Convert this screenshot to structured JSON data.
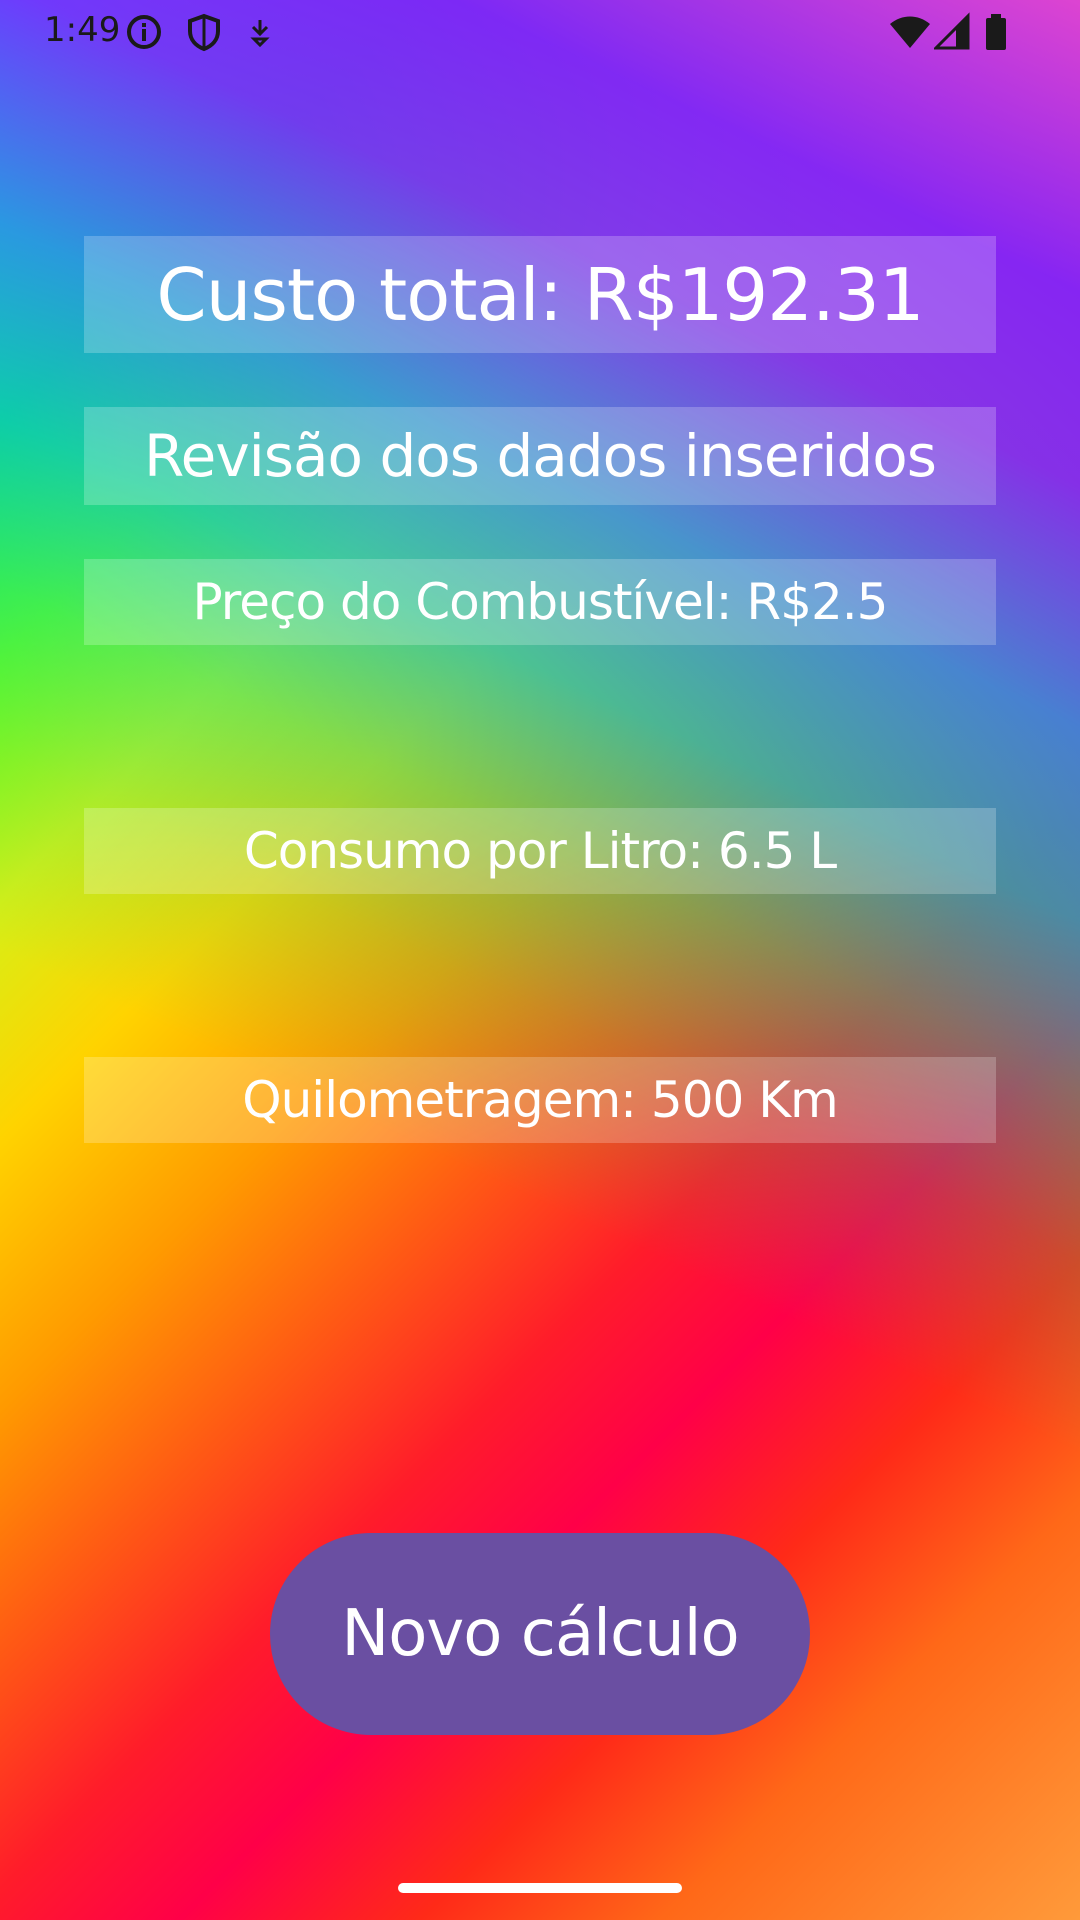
{
  "status_bar": {
    "time": "1:49",
    "icons_left": [
      "info-icon",
      "shield-icon",
      "download-icon"
    ],
    "icons_right": [
      "wifi-icon",
      "cell-signal-icon",
      "battery-icon"
    ],
    "icon_color": "#1a1a1a"
  },
  "result": {
    "total_cost": "Custo total: R$192.31",
    "review_title": "Revisão dos dados inseridos",
    "fuel_price": "Preço do Combustível: R$2.5",
    "consumption": "Consumo por Litro: 6.5 L",
    "mileage": "Quilometragem: 500 Km"
  },
  "actions": {
    "new_calc_label": "Novo cálculo",
    "button_color": "#6a4fa2"
  }
}
